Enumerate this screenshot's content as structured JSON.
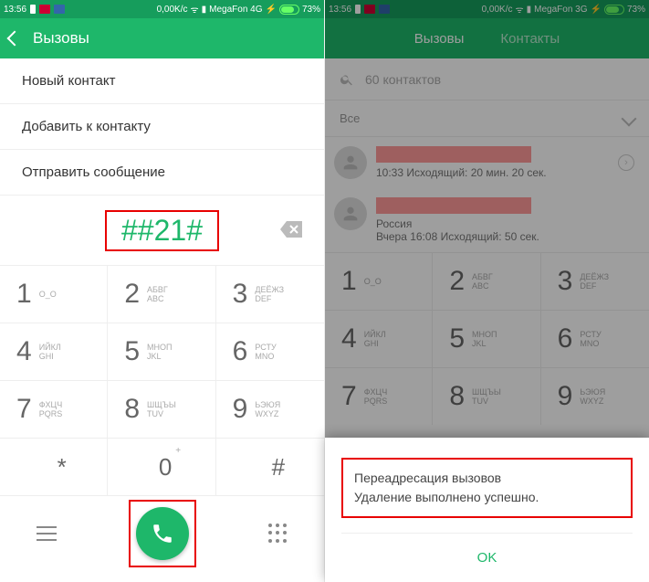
{
  "left": {
    "status": {
      "time": "13:56",
      "speed": "0,00K/c",
      "carrier": "MegaFon 4G",
      "battery": "73%"
    },
    "header": {
      "title": "Вызовы"
    },
    "menu": {
      "new_contact": "Новый контакт",
      "add_to_contact": "Добавить к контакту",
      "send_message": "Отправить сообщение"
    },
    "dialed": "##21#",
    "keypad": [
      {
        "d": "1",
        "ru": "",
        "en": "O_O"
      },
      {
        "d": "2",
        "ru": "АБВГ",
        "en": "ABC"
      },
      {
        "d": "3",
        "ru": "ДЕЁЖЗ",
        "en": "DEF"
      },
      {
        "d": "4",
        "ru": "ИЙКЛ",
        "en": "GHI"
      },
      {
        "d": "5",
        "ru": "МНОП",
        "en": "JKL"
      },
      {
        "d": "6",
        "ru": "РСТУ",
        "en": "MNO"
      },
      {
        "d": "7",
        "ru": "ФХЦЧ",
        "en": "PQRS"
      },
      {
        "d": "8",
        "ru": "ШЩЪЫ",
        "en": "TUV"
      },
      {
        "d": "9",
        "ru": "ЬЭЮЯ",
        "en": "WXYZ"
      },
      {
        "d": "*",
        "ru": "",
        "en": ""
      },
      {
        "d": "0",
        "ru": "",
        "en": "+"
      },
      {
        "d": "#",
        "ru": "",
        "en": ""
      }
    ]
  },
  "right": {
    "status": {
      "time": "13:56",
      "speed": "0,00K/c",
      "carrier": "MegaFon 3G",
      "battery": "73%"
    },
    "tabs": {
      "calls": "Вызовы",
      "contacts": "Контакты"
    },
    "search_placeholder": "60 контактов",
    "filter": "Все",
    "entries": [
      {
        "meta": "10:33 Исходящий: 20 мин. 20 сек."
      },
      {
        "country": "Россия",
        "meta": "Вчера 16:08 Исходящий: 50 сек."
      }
    ],
    "dialog": {
      "line1": "Переадресация вызовов",
      "line2": "Удаление выполнено успешно.",
      "ok": "OK"
    }
  }
}
